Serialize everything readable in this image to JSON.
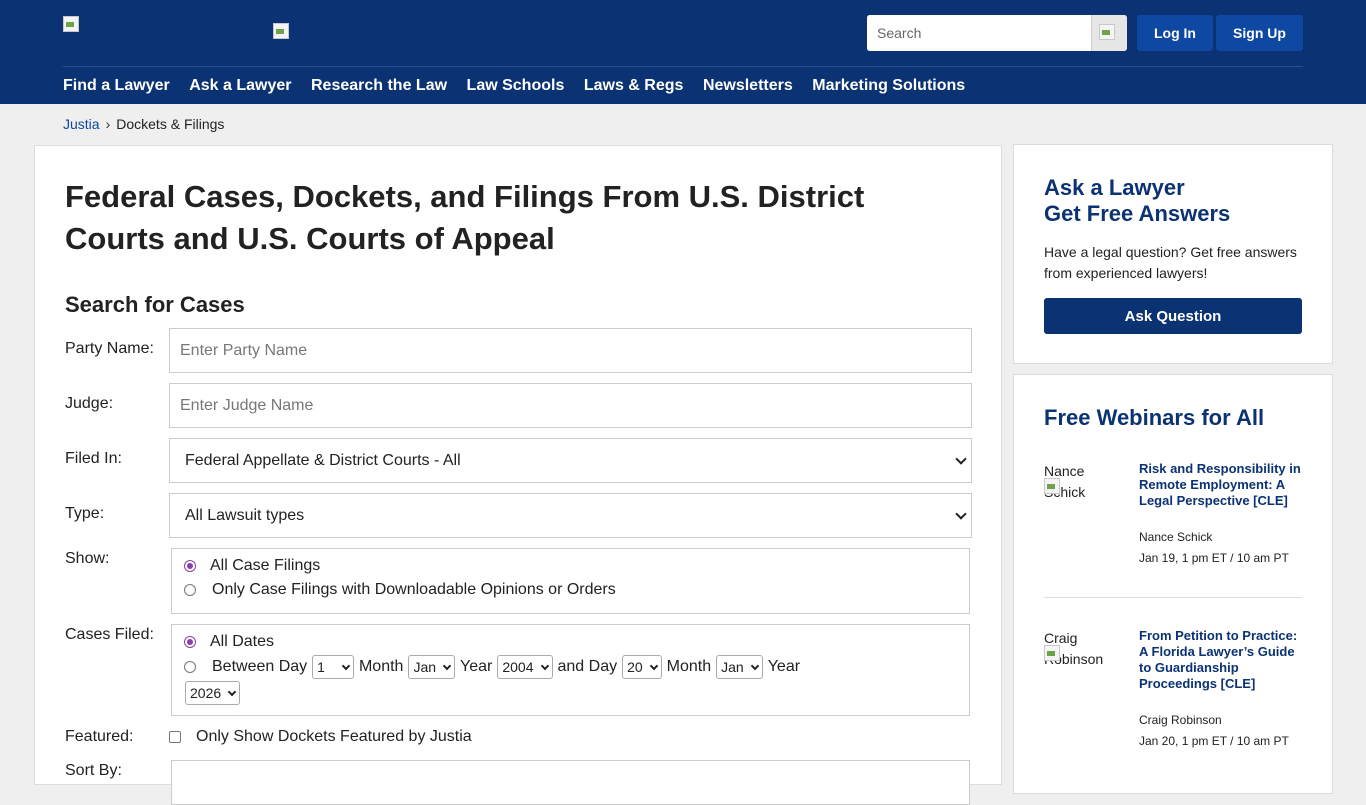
{
  "header": {
    "search_placeholder": "Search",
    "login_label": "Log In",
    "signup_label": "Sign Up",
    "nav": [
      "Find a Lawyer",
      "Ask a Lawyer",
      "Research the Law",
      "Law Schools",
      "Laws & Regs",
      "Newsletters",
      "Marketing Solutions"
    ]
  },
  "breadcrumb": {
    "home": "Justia",
    "separator": "›",
    "current": "Dockets & Filings"
  },
  "main": {
    "title": "Federal Cases, Dockets, and Filings From U.S. District Courts and U.S. Courts of Appeal",
    "section_title": "Search for Cases",
    "party_label": "Party Name:",
    "party_placeholder": "Enter Party Name",
    "judge_label": "Judge:",
    "judge_placeholder": "Enter Judge Name",
    "filed_in_label": "Filed In:",
    "filed_in_value": "Federal Appellate & District Courts - All",
    "type_label": "Type:",
    "type_value": "All Lawsuit types",
    "show_label": "Show:",
    "show_opt1": "All Case Filings",
    "show_opt2": "Only Case Filings with Downloadable Opinions or Orders",
    "cases_filed_label": "Cases Filed:",
    "dates_opt1": "All Dates",
    "between_day": "Between Day",
    "month_word": "Month",
    "year_word": "Year",
    "and_day": "and Day",
    "from_day": "1",
    "from_month": "Jan",
    "from_year": "2004",
    "to_day": "20",
    "to_month": "Jan",
    "to_year": "2026",
    "featured_label": "Featured:",
    "featured_opt": "Only Show Dockets Featured by Justia",
    "sort_label": "Sort By:"
  },
  "sidebar": {
    "ask_title_1": "Ask a Lawyer",
    "ask_title_2": "Get Free Answers",
    "ask_text": "Have a legal question? Get free answers from experienced lawyers!",
    "ask_button": "Ask Question",
    "webinars_title": "Free Webinars for All",
    "webinars": [
      {
        "alt": "Nance Schick",
        "title": "Risk and Responsibility in Remote Employment: A Legal Perspective [CLE]",
        "presenter": "Nance Schick",
        "when": "Jan 19, 1 pm ET / 10 am PT"
      },
      {
        "alt": "Craig Robinson",
        "title": "From Petition to Practice: A Florida Lawyer’s Guide to Guardianship Proceedings [CLE]",
        "presenter": "Craig Robinson",
        "when": "Jan 20, 1 pm ET / 10 am PT"
      }
    ]
  }
}
